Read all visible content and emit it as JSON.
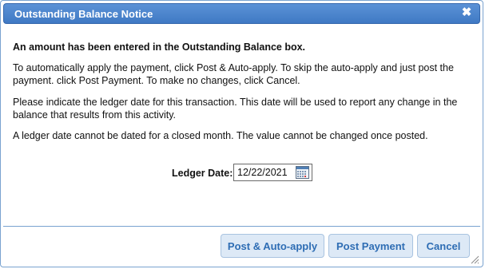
{
  "dialog": {
    "title": "Outstanding Balance Notice",
    "close_icon": "close-x-icon"
  },
  "content": {
    "lead": "An amount has been entered in the Outstanding Balance box.",
    "paragraph_1": "To automatically apply the payment, click Post & Auto-apply. To skip the auto-apply and just post the payment. click Post Payment. To make no changes, click Cancel.",
    "paragraph_2": "Please indicate the ledger date for this transaction. This date will be used to report any change in the balance that results from this activity.",
    "paragraph_3": "A ledger date cannot be dated for a closed month. The value cannot be changed once posted."
  },
  "ledger": {
    "label": "Ledger Date:",
    "value": "12/22/2021",
    "calendar_icon": "calendar-icon"
  },
  "buttons": {
    "post_auto_apply": "Post & Auto-apply",
    "post_payment": "Post Payment",
    "cancel": "Cancel"
  },
  "colors": {
    "titlebar": "#4a86cf",
    "button_bg": "#dde9f6",
    "button_text": "#2e6db4",
    "border": "#7aa3d0"
  }
}
